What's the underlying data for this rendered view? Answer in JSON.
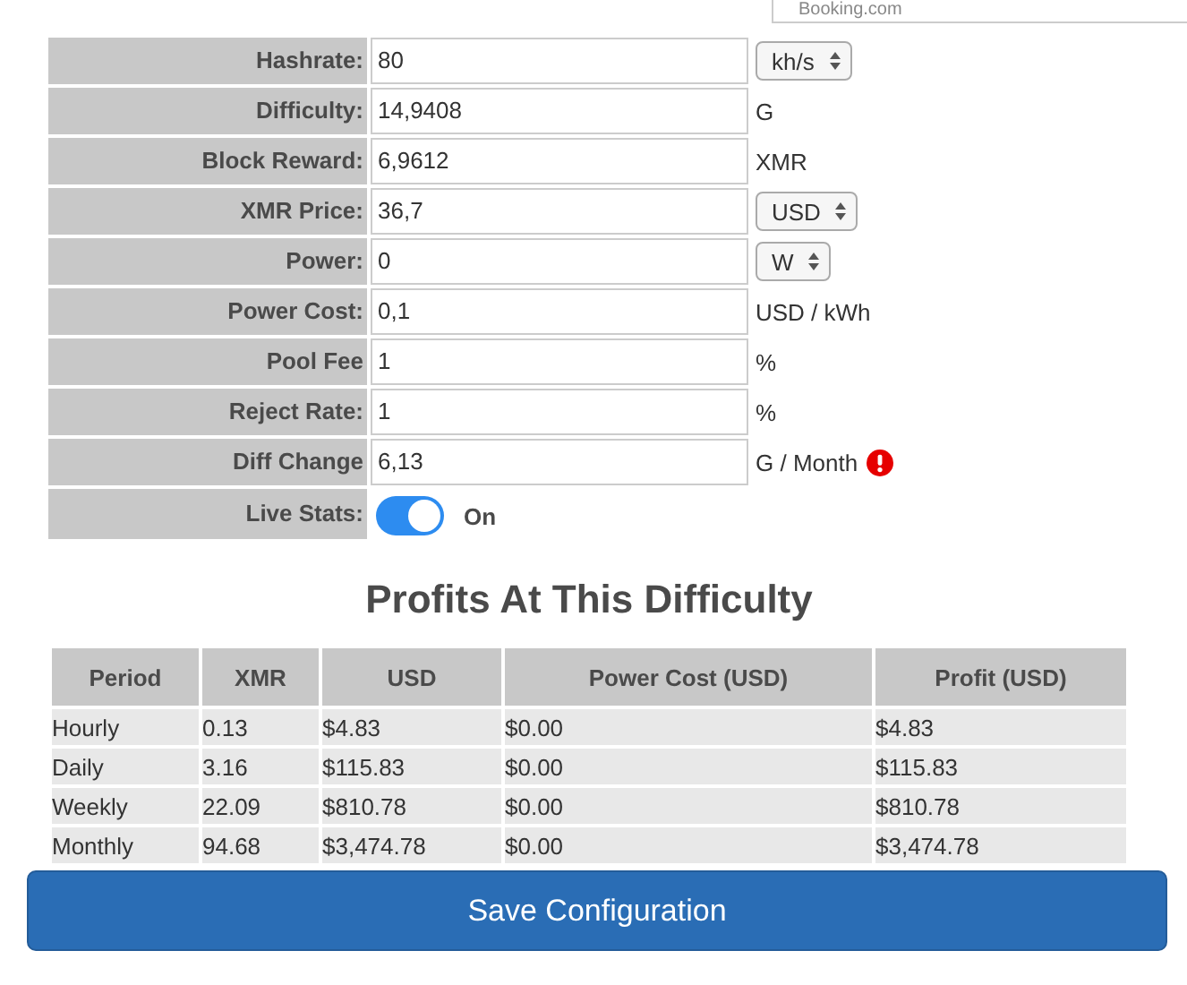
{
  "ad_frame": {
    "text": "Booking.com"
  },
  "settings": [
    {
      "label": "Hashrate:",
      "value": "80",
      "kind": "select",
      "unit": "kh/s",
      "warning": false
    },
    {
      "label": "Difficulty:",
      "value": "14,9408",
      "kind": "text",
      "unit": "G",
      "warning": false
    },
    {
      "label": "Block Reward:",
      "value": "6,9612",
      "kind": "text",
      "unit": "XMR",
      "warning": false
    },
    {
      "label": "XMR Price:",
      "value": "36,7",
      "kind": "select",
      "unit": "USD",
      "warning": false
    },
    {
      "label": "Power:",
      "value": "0",
      "kind": "select",
      "unit": "W",
      "warning": false
    },
    {
      "label": "Power Cost:",
      "value": "0,1",
      "kind": "text",
      "unit": "USD / kWh",
      "warning": false
    },
    {
      "label": "Pool Fee",
      "value": "1",
      "kind": "text",
      "unit": "%",
      "warning": false
    },
    {
      "label": "Reject Rate:",
      "value": "1",
      "kind": "text",
      "unit": "%",
      "warning": false
    },
    {
      "label": "Diff Change",
      "value": "6,13",
      "kind": "text",
      "unit": "G / Month",
      "warning": true
    }
  ],
  "live_stats": {
    "label": "Live Stats:",
    "on": true,
    "state_text": "On"
  },
  "profits_title": "Profits At This Difficulty",
  "table": {
    "columns": [
      "Period",
      "XMR",
      "USD",
      "Power Cost (USD)",
      "Profit (USD)"
    ],
    "rows": [
      [
        "Hourly",
        "0.13",
        "$4.83",
        "$0.00",
        "$4.83"
      ],
      [
        "Daily",
        "3.16",
        "$115.83",
        "$0.00",
        "$115.83"
      ],
      [
        "Weekly",
        "22.09",
        "$810.78",
        "$0.00",
        "$810.78"
      ],
      [
        "Monthly",
        "94.68",
        "$3,474.78",
        "$0.00",
        "$3,474.78"
      ]
    ]
  },
  "save_button": "Save Configuration"
}
